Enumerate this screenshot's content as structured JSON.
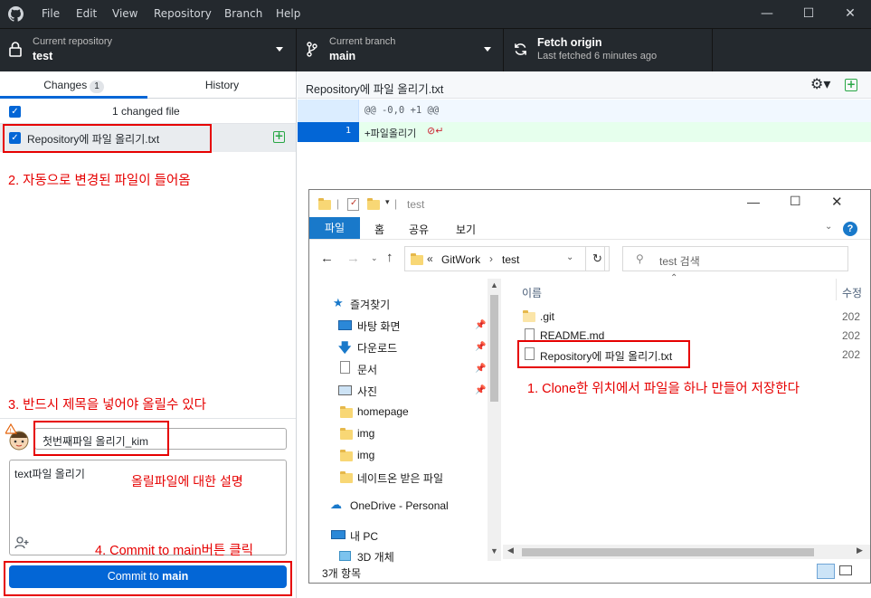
{
  "titlebar": {
    "menu": [
      "File",
      "Edit",
      "View",
      "Repository",
      "Branch",
      "Help"
    ]
  },
  "toolbar": {
    "repo_label": "Current repository",
    "repo_value": "test",
    "branch_label": "Current branch",
    "branch_value": "main",
    "fetch_label": "Fetch origin",
    "fetch_sub": "Last fetched 6 minutes ago"
  },
  "tabs": {
    "changes": "Changes",
    "changes_count": "1",
    "history": "History"
  },
  "changes": {
    "summary": "1 changed file",
    "file_name": "Repository에 파일 올리기.txt"
  },
  "commit": {
    "summary_value": "첫번째파일 올리기_kim",
    "description_value": "text파일 올리기",
    "button_prefix": "Commit to ",
    "button_branch": "main"
  },
  "diff": {
    "file_path": "Repository에 파일 올리기.txt",
    "hunk_header": "@@ -0,0 +1 @@",
    "line_number": "1",
    "added_line": "+파일올리기"
  },
  "annotations": {
    "a1": "1. Clone한 위치에서 파일을 하나 만들어 저장한다",
    "a2": "2. 자동으로 변경된 파일이 들어옴",
    "a3": "3. 반드시 제목을 넣어야 올릴수 있다",
    "a4": "4. Commit to main버튼 클릭",
    "desc_note": "올릴파일에 대한 설명"
  },
  "explorer": {
    "title": "test",
    "ribbon_tabs": [
      "파일",
      "홈",
      "공유",
      "보기"
    ],
    "breadcrumb_root": "GitWork",
    "breadcrumb_current": "test",
    "search_placeholder": "test 검색",
    "nav": {
      "quick_access": "즐겨찾기",
      "desktop": "바탕 화면",
      "downloads": "다운로드",
      "documents": "문서",
      "pictures": "사진",
      "homepage": "homepage",
      "img1": "img",
      "img2": "img",
      "nateon": "네이트온 받은 파일",
      "onedrive": "OneDrive - Personal",
      "this_pc": "내 PC",
      "objects3d": "3D 개체"
    },
    "columns": {
      "name": "이름",
      "modified": "수정"
    },
    "files": [
      {
        "name": ".git",
        "date": "202"
      },
      {
        "name": "README.md",
        "date": "202"
      },
      {
        "name": "Repository에 파일 올리기.txt",
        "date": "202"
      }
    ],
    "status": "3개 항목"
  }
}
